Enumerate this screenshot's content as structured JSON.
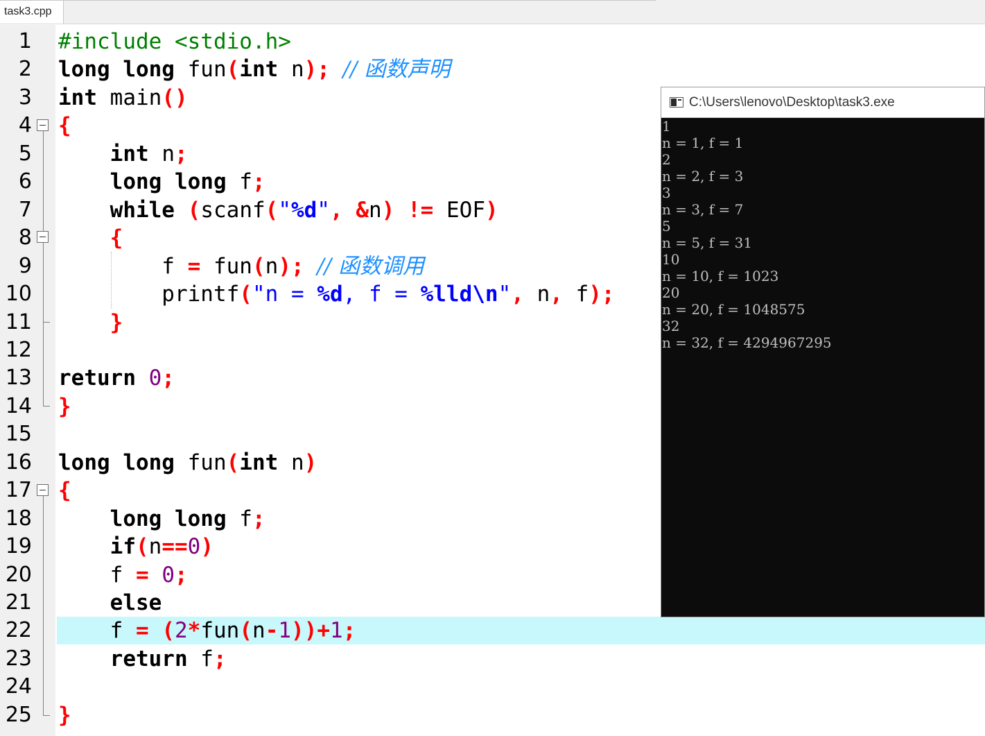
{
  "tab": {
    "filename": "task3.cpp"
  },
  "editor": {
    "highlighted_line": 22,
    "lines": [
      {
        "n": "1",
        "tokens": [
          {
            "t": "#include <stdio.h>",
            "c": "pp"
          }
        ]
      },
      {
        "n": "2",
        "tokens": [
          {
            "t": "long long",
            "c": "kw"
          },
          {
            "t": " fun"
          },
          {
            "t": "(",
            "c": "op"
          },
          {
            "t": "int",
            "c": "kw"
          },
          {
            "t": " n"
          },
          {
            "t": ");",
            "c": "op"
          },
          {
            "t": " "
          },
          {
            "t": "// 函数声明",
            "c": "cm"
          }
        ]
      },
      {
        "n": "3",
        "tokens": [
          {
            "t": "int",
            "c": "kw"
          },
          {
            "t": " main"
          },
          {
            "t": "()",
            "c": "op"
          }
        ]
      },
      {
        "n": "4",
        "tokens": [
          {
            "t": "{",
            "c": "op"
          }
        ]
      },
      {
        "n": "5",
        "tokens": [
          {
            "t": "    "
          },
          {
            "t": "int",
            "c": "kw"
          },
          {
            "t": " n"
          },
          {
            "t": ";",
            "c": "op"
          }
        ]
      },
      {
        "n": "6",
        "tokens": [
          {
            "t": "    "
          },
          {
            "t": "long long",
            "c": "kw"
          },
          {
            "t": " f"
          },
          {
            "t": ";",
            "c": "op"
          }
        ]
      },
      {
        "n": "7",
        "tokens": [
          {
            "t": "    "
          },
          {
            "t": "while",
            "c": "kw"
          },
          {
            "t": " "
          },
          {
            "t": "(",
            "c": "op"
          },
          {
            "t": "scanf"
          },
          {
            "t": "(",
            "c": "op"
          },
          {
            "t": "\"",
            "c": "str"
          },
          {
            "t": "%d",
            "c": "esc"
          },
          {
            "t": "\"",
            "c": "str"
          },
          {
            "t": ", &",
            "c": "op"
          },
          {
            "t": "n"
          },
          {
            "t": ")",
            "c": "op"
          },
          {
            "t": " "
          },
          {
            "t": "!=",
            "c": "op"
          },
          {
            "t": " EOF"
          },
          {
            "t": ")",
            "c": "op"
          }
        ]
      },
      {
        "n": "8",
        "tokens": [
          {
            "t": "    "
          },
          {
            "t": "{",
            "c": "op"
          }
        ]
      },
      {
        "n": "9",
        "tokens": [
          {
            "t": "        f "
          },
          {
            "t": "=",
            "c": "op"
          },
          {
            "t": " fun"
          },
          {
            "t": "(",
            "c": "op"
          },
          {
            "t": "n"
          },
          {
            "t": ");",
            "c": "op"
          },
          {
            "t": " "
          },
          {
            "t": "// 函数调用",
            "c": "cm"
          }
        ]
      },
      {
        "n": "10",
        "tokens": [
          {
            "t": "        printf"
          },
          {
            "t": "(",
            "c": "op"
          },
          {
            "t": "\"n = ",
            "c": "str"
          },
          {
            "t": "%d",
            "c": "esc"
          },
          {
            "t": ", f = ",
            "c": "str"
          },
          {
            "t": "%lld\\n",
            "c": "esc"
          },
          {
            "t": "\"",
            "c": "str"
          },
          {
            "t": ",",
            "c": "op"
          },
          {
            "t": " n"
          },
          {
            "t": ",",
            "c": "op"
          },
          {
            "t": " f"
          },
          {
            "t": ");",
            "c": "op"
          }
        ]
      },
      {
        "n": "11",
        "tokens": [
          {
            "t": "    "
          },
          {
            "t": "}",
            "c": "op"
          }
        ]
      },
      {
        "n": "12",
        "tokens": []
      },
      {
        "n": "13",
        "tokens": [
          {
            "t": "return",
            "c": "kw"
          },
          {
            "t": " "
          },
          {
            "t": "0",
            "c": "num"
          },
          {
            "t": ";",
            "c": "op"
          }
        ]
      },
      {
        "n": "14",
        "tokens": [
          {
            "t": "}",
            "c": "op"
          }
        ]
      },
      {
        "n": "15",
        "tokens": []
      },
      {
        "n": "16",
        "tokens": [
          {
            "t": "long long",
            "c": "kw"
          },
          {
            "t": " fun"
          },
          {
            "t": "(",
            "c": "op"
          },
          {
            "t": "int",
            "c": "kw"
          },
          {
            "t": " n"
          },
          {
            "t": ")",
            "c": "op"
          }
        ]
      },
      {
        "n": "17",
        "tokens": [
          {
            "t": "{",
            "c": "op"
          }
        ]
      },
      {
        "n": "18",
        "tokens": [
          {
            "t": "    "
          },
          {
            "t": "long long",
            "c": "kw"
          },
          {
            "t": " f"
          },
          {
            "t": ";",
            "c": "op"
          }
        ]
      },
      {
        "n": "19",
        "tokens": [
          {
            "t": "    "
          },
          {
            "t": "if",
            "c": "kw"
          },
          {
            "t": "(",
            "c": "op"
          },
          {
            "t": "n"
          },
          {
            "t": "==",
            "c": "op"
          },
          {
            "t": "0",
            "c": "num"
          },
          {
            "t": ")",
            "c": "op"
          }
        ]
      },
      {
        "n": "20",
        "tokens": [
          {
            "t": "    f "
          },
          {
            "t": "=",
            "c": "op"
          },
          {
            "t": " "
          },
          {
            "t": "0",
            "c": "num"
          },
          {
            "t": ";",
            "c": "op"
          }
        ]
      },
      {
        "n": "21",
        "tokens": [
          {
            "t": "    "
          },
          {
            "t": "else",
            "c": "kw"
          }
        ]
      },
      {
        "n": "22",
        "tokens": [
          {
            "t": "    f "
          },
          {
            "t": "=",
            "c": "op"
          },
          {
            "t": " "
          },
          {
            "t": "(",
            "c": "op"
          },
          {
            "t": "2",
            "c": "num"
          },
          {
            "t": "*",
            "c": "op"
          },
          {
            "t": "fun"
          },
          {
            "t": "(",
            "c": "op"
          },
          {
            "t": "n"
          },
          {
            "t": "-",
            "c": "op"
          },
          {
            "t": "1",
            "c": "num"
          },
          {
            "t": "))+",
            "c": "op"
          },
          {
            "t": "1",
            "c": "num"
          },
          {
            "t": ";",
            "c": "op"
          }
        ]
      },
      {
        "n": "23",
        "tokens": [
          {
            "t": "    "
          },
          {
            "t": "return",
            "c": "kw"
          },
          {
            "t": " f"
          },
          {
            "t": ";",
            "c": "op"
          }
        ]
      },
      {
        "n": "24",
        "tokens": []
      },
      {
        "n": "25",
        "tokens": [
          {
            "t": "}",
            "c": "op"
          }
        ]
      }
    ]
  },
  "console": {
    "title": "C:\\Users\\lenovo\\Desktop\\task3.exe",
    "lines": [
      "1",
      "n = 1, f = 1",
      "2",
      "n = 2, f = 3",
      "3",
      "n = 3, f = 7",
      "5",
      "n = 5, f = 31",
      "10",
      "n = 10, f = 1023",
      "20",
      "n = 20, f = 1048575",
      "32",
      "n = 32, f = 4294967295"
    ]
  },
  "colors": {
    "keyword": "#000000",
    "preprocessor": "#008000",
    "operator": "#ff0000",
    "string": "#0000ff",
    "number": "#800080",
    "comment": "#1e90ff",
    "current_line": "#c8f8fb",
    "console_bg": "#0c0c0c",
    "console_text": "#c0c0c0"
  }
}
